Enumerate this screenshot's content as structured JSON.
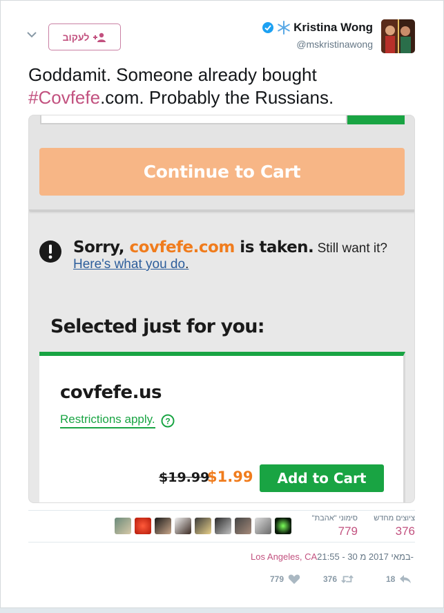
{
  "header": {
    "follow_label": "לעקוב",
    "user_name": "Kristina Wong",
    "handle": "@mskristinawong",
    "snow_glyph": "❄"
  },
  "tweet": {
    "text_before": "Goddamit. Someone already bought ",
    "hashtag": "#Covfefe",
    "text_after": ".com. Probably the Russians."
  },
  "media": {
    "continue_label": "Continue to Cart",
    "sorry_prefix": "Sorry, ",
    "taken_domain": "covfefe.com",
    "sorry_suffix": " is taken.",
    "still_want": " Still want it?",
    "help_link": "Here's what you do",
    "help_period": ".",
    "selected_heading": "Selected just for you:",
    "offer": {
      "domain": "covfefe.us",
      "restrictions": "Restrictions apply.",
      "old_price": "$19.99",
      "new_price": "$1.99",
      "add_label": "Add to Cart"
    },
    "colors": {
      "accent_green": "#19a443",
      "orange": "#f07c1d",
      "continue_bg": "#f7b686"
    }
  },
  "stats": {
    "retweets_label": "ציוצים מחדש",
    "retweets_value": "376",
    "likes_label": "סימוני \"אהבת\"",
    "likes_value": "779"
  },
  "meta": {
    "time": "21:55 - 30 במאי 2017 מ-",
    "location": "Los Angeles, CA"
  },
  "actions": {
    "likes": "779",
    "retweets": "376",
    "replies": "18"
  },
  "brand_color": "#c2517f"
}
